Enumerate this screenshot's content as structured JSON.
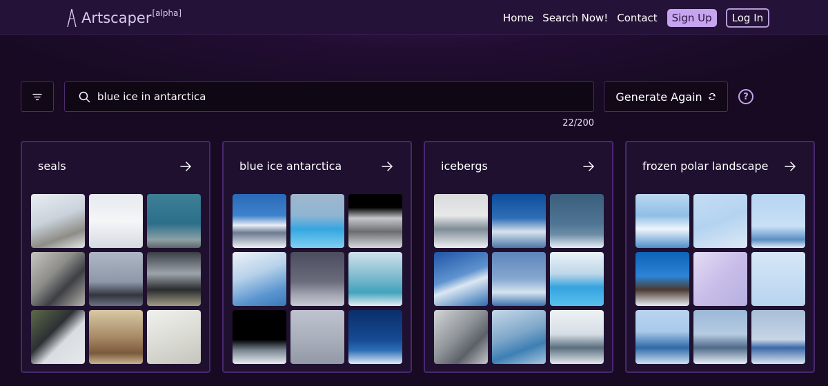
{
  "brand": {
    "name": "Artscaper",
    "tag": "[alpha]"
  },
  "nav": {
    "links": [
      "Home",
      "Search Now!",
      "Contact"
    ],
    "signup_label": "Sign Up",
    "login_label": "Log In"
  },
  "search": {
    "value": "blue ice in antarctica",
    "char_count": "22/200"
  },
  "generate": {
    "label": "Generate Again"
  },
  "help": {
    "label": "?"
  },
  "colors": {
    "accent": "#c6a4ef",
    "background": "#170a22",
    "navbar": "#251238",
    "card": "#1f1030",
    "border": "#4a2770"
  },
  "cards": [
    {
      "title": "seals",
      "tiles": [
        "linear-gradient(160deg,#e8edf2 0%,#c9d2db 45%,#8e8c86 75%,#e3e6e8 100%)",
        "linear-gradient(180deg,#e6eaee 0%,#f4f6f8 50%,#d5dbe1 100%)",
        "linear-gradient(180deg,#3d7f95 0%,#2c6f8a 55%,#8da0a6 85%,#5e676a 100%)",
        "linear-gradient(135deg,#c8c5bf 0%,#8d8d8a 40%,#3d3f43 65%,#b6b4ad 100%)",
        "linear-gradient(180deg,#aeb7c4 0%,#8e98a9 55%,#33353e 80%,#6b7282 100%)",
        "linear-gradient(180deg,#3b3f45 0%,#9da4ab 40%,#2a2c2e 70%,#a29c86 100%)",
        "linear-gradient(135deg,#5e6a48 0%,#2c3034 40%,#d9dde2 60%,#e6e9ec 100%)",
        "linear-gradient(180deg,#d8c9a6 0%,#a88a66 50%,#7a5a3c 80%,#c7b38f 100%)",
        "linear-gradient(160deg,#f0f0ed 0%,#dcdcd6 50%,#c5c5bd 100%)"
      ]
    },
    {
      "title": "blue ice antarctica",
      "tiles": [
        "linear-gradient(180deg,#2a69b8 0%,#3f82cc 40%,#e9eef5 58%,#6c7a91 72%,#eef2f6 100%)",
        "linear-gradient(180deg,#9fb7cc 0%,#8fb5d3 40%,#35a6e0 65%,#7fd0f2 100%)",
        "linear-gradient(180deg,#000000 0%,#000000 25%,#c5c7cb 45%,#6c6d70 70%,#d8d9dc 100%)",
        "linear-gradient(160deg,#ecf2f7 0%,#b8d2ea 40%,#5a95cf 75%,#3a78b8 100%)",
        "linear-gradient(180deg,#4b4d5e 0%,#6a6c7c 55%,#a4a6b3 80%,#c9cad2 100%)",
        "linear-gradient(180deg,#cfe2ec 0%,#7fbccf 45%,#43a2bd 75%,#e4eef2 100%)",
        "linear-gradient(180deg,#000000 0%,#000000 55%,#7b8693 75%,#e7ecef 100%)",
        "linear-gradient(180deg,#bec3cf 0%,#a9aebb 55%,#9398a6 100%)",
        "linear-gradient(180deg,#0b2e6a 0%,#154a92 55%,#2d6eb8 75%,#e0ebf5 100%)"
      ]
    },
    {
      "title": "icebergs",
      "tiles": [
        "linear-gradient(180deg,#d9dadc 0%,#e8e8e9 40%,#7f8c97 65%,#eef0f2 100%)",
        "linear-gradient(180deg,#0e4c9c 0%,#2f6fb6 45%,#d8e2ec 70%,#4a78a8 100%)",
        "linear-gradient(180deg,#3a5e7c 0%,#4f7594 55%,#6c8da6 75%,#e7eef4 100%)",
        "linear-gradient(160deg,#1f55a6 0%,#5f93cf 45%,#dbe7f2 60%,#2c6db2 100%)",
        "linear-gradient(180deg,#5d85bb 0%,#86a8d0 50%,#d5e3f0 75%,#3d72ad 100%)",
        "linear-gradient(180deg,#eaf2f9 0%,#bfd7e8 40%,#36a3df 65%,#58c0ee 100%)",
        "linear-gradient(135deg,#d3d5d6 0%,#8f9499 45%,#5c6168 70%,#c5c8cb 100%)",
        "linear-gradient(160deg,#c6d8e8 0%,#7fa7c9 45%,#3d7fb4 70%,#a8c6de 100%)",
        "linear-gradient(180deg,#eef2f5 0%,#d5dde4 45%,#5a6e7f 70%,#e3e8ec 100%)"
      ]
    },
    {
      "title": "frozen polar landscape",
      "tiles": [
        "linear-gradient(180deg,#bcd7f0 0%,#8fbfe6 40%,#eef5fb 65%,#4f8fcb 100%)",
        "linear-gradient(160deg,#c4dcf4 0%,#b4d3f0 50%,#dde9f6 100%)",
        "linear-gradient(180deg,#b6d4f2 0%,#c9e0f6 60%,#5a8fc2 85%,#e4eef8 100%)",
        "linear-gradient(180deg,#0d63b8 0%,#2d84d6 45%,#4b3a30 70%,#e8edf2 100%)",
        "linear-gradient(135deg,#e4dcf4 0%,#c9bde9 50%,#b5b0e0 100%)",
        "linear-gradient(180deg,#d5e6f7 0%,#c3dcf3 60%,#b8d4ef 100%)",
        "linear-gradient(180deg,#b9d4f0 0%,#a8c9ea 40%,#2f6aa8 70%,#cfe0f2 100%)",
        "linear-gradient(180deg,#9cb8d8 0%,#b5cbe2 45%,#4f6a88 70%,#e6eef6 100%)",
        "linear-gradient(180deg,#a9bed8 0%,#c6d5e6 55%,#3c68a8 70%,#d9e4ef 100%)"
      ]
    }
  ]
}
